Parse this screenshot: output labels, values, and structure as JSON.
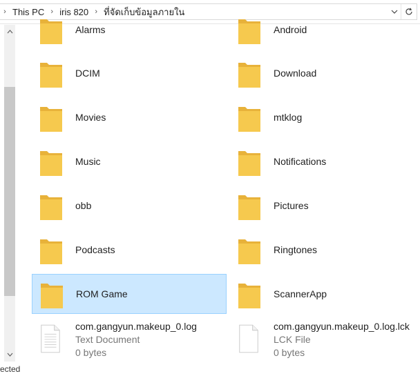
{
  "address": {
    "crumbs": [
      "This PC",
      "iris 820",
      "ที่จัดเก็บข้อมูลภายใน"
    ]
  },
  "status": {
    "text": "ected"
  },
  "folders": [
    {
      "name": "Alarms"
    },
    {
      "name": "Android"
    },
    {
      "name": "DCIM"
    },
    {
      "name": "Download"
    },
    {
      "name": "Movies"
    },
    {
      "name": "mtklog"
    },
    {
      "name": "Music"
    },
    {
      "name": "Notifications"
    },
    {
      "name": "obb"
    },
    {
      "name": "Pictures"
    },
    {
      "name": "Podcasts"
    },
    {
      "name": "Ringtones"
    },
    {
      "name": "ROM Game"
    },
    {
      "name": "ScannerApp"
    }
  ],
  "files": [
    {
      "name": "com.gangyun.makeup_0.log",
      "type": "Text Document",
      "size": "0 bytes"
    },
    {
      "name": "com.gangyun.makeup_0.log.lck",
      "type": "LCK File",
      "size": "0 bytes"
    }
  ],
  "colors": {
    "folder": "#f6c94e",
    "folder_dark": "#e8b23a",
    "selection_bg": "#cce8ff",
    "selection_border": "#99d1ff"
  }
}
